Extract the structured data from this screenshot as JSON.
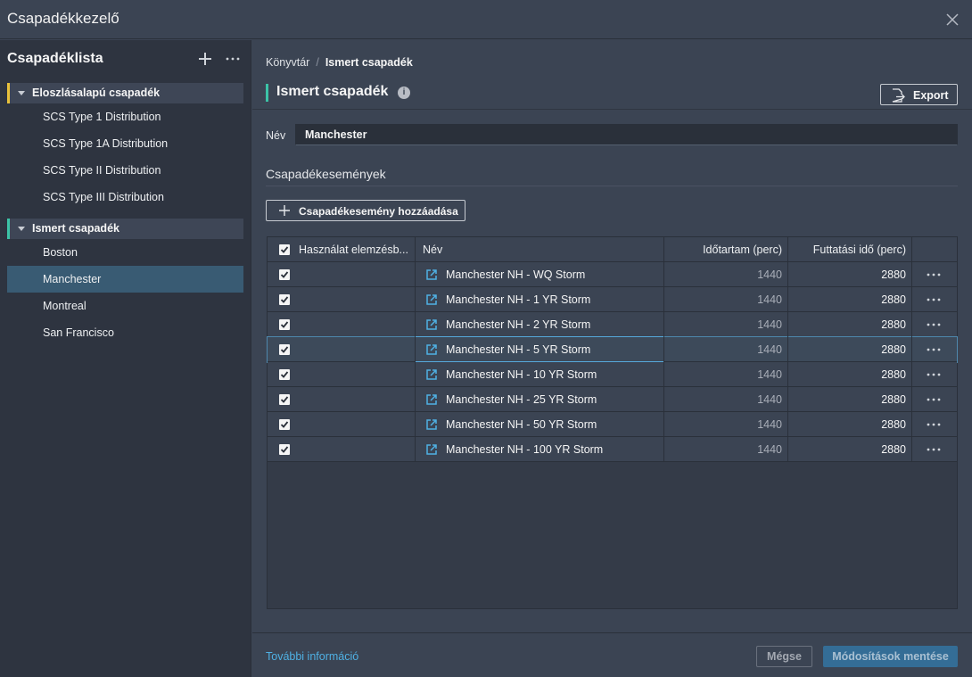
{
  "window": {
    "title": "Csapadékkezelő"
  },
  "sidebar": {
    "title": "Csapadéklista",
    "groups": [
      {
        "label": "Eloszlásalapú csapadék",
        "color": "#e8c13b",
        "items": [
          "SCS Type 1 Distribution",
          "SCS Type 1A Distribution",
          "SCS Type II Distribution",
          "SCS Type III Distribution"
        ]
      },
      {
        "label": "Ismert csapadék",
        "color": "#3cc3a7",
        "items": [
          "Boston",
          "Manchester",
          "Montreal",
          "San Francisco"
        ]
      }
    ],
    "selected_item": "Manchester"
  },
  "breadcrumb": {
    "root": "Könyvtár",
    "separator": "/",
    "current": "Ismert csapadék"
  },
  "main": {
    "heading": "Ismert csapadék",
    "info_icon": "i",
    "export_label": "Export",
    "name_label": "Név",
    "name_value": "Manchester",
    "section_title": "Csapadékesemények",
    "add_event_label": "Csapadékesemény hozzáadása"
  },
  "table": {
    "headers": {
      "use": "Használat elemzésb...",
      "name": "Név",
      "duration": "Időtartam (perc)",
      "runtime": "Futtatási idő (perc)"
    },
    "rows": [
      {
        "checked": true,
        "name": "Manchester NH - WQ Storm",
        "duration": "1440",
        "runtime": "2880"
      },
      {
        "checked": true,
        "name": "Manchester NH - 1 YR Storm",
        "duration": "1440",
        "runtime": "2880"
      },
      {
        "checked": true,
        "name": "Manchester NH - 2 YR Storm",
        "duration": "1440",
        "runtime": "2880"
      },
      {
        "checked": true,
        "name": "Manchester NH - 5 YR Storm",
        "duration": "1440",
        "runtime": "2880"
      },
      {
        "checked": true,
        "name": "Manchester NH - 10 YR Storm",
        "duration": "1440",
        "runtime": "2880"
      },
      {
        "checked": true,
        "name": "Manchester NH - 25 YR Storm",
        "duration": "1440",
        "runtime": "2880"
      },
      {
        "checked": true,
        "name": "Manchester NH - 50 YR Storm",
        "duration": "1440",
        "runtime": "2880"
      },
      {
        "checked": true,
        "name": "Manchester NH - 100 YR Storm",
        "duration": "1440",
        "runtime": "2880"
      }
    ],
    "selected_row": 3
  },
  "footer": {
    "more_info": "További információ",
    "cancel": "Mégse",
    "save": "Módosítások mentése"
  }
}
